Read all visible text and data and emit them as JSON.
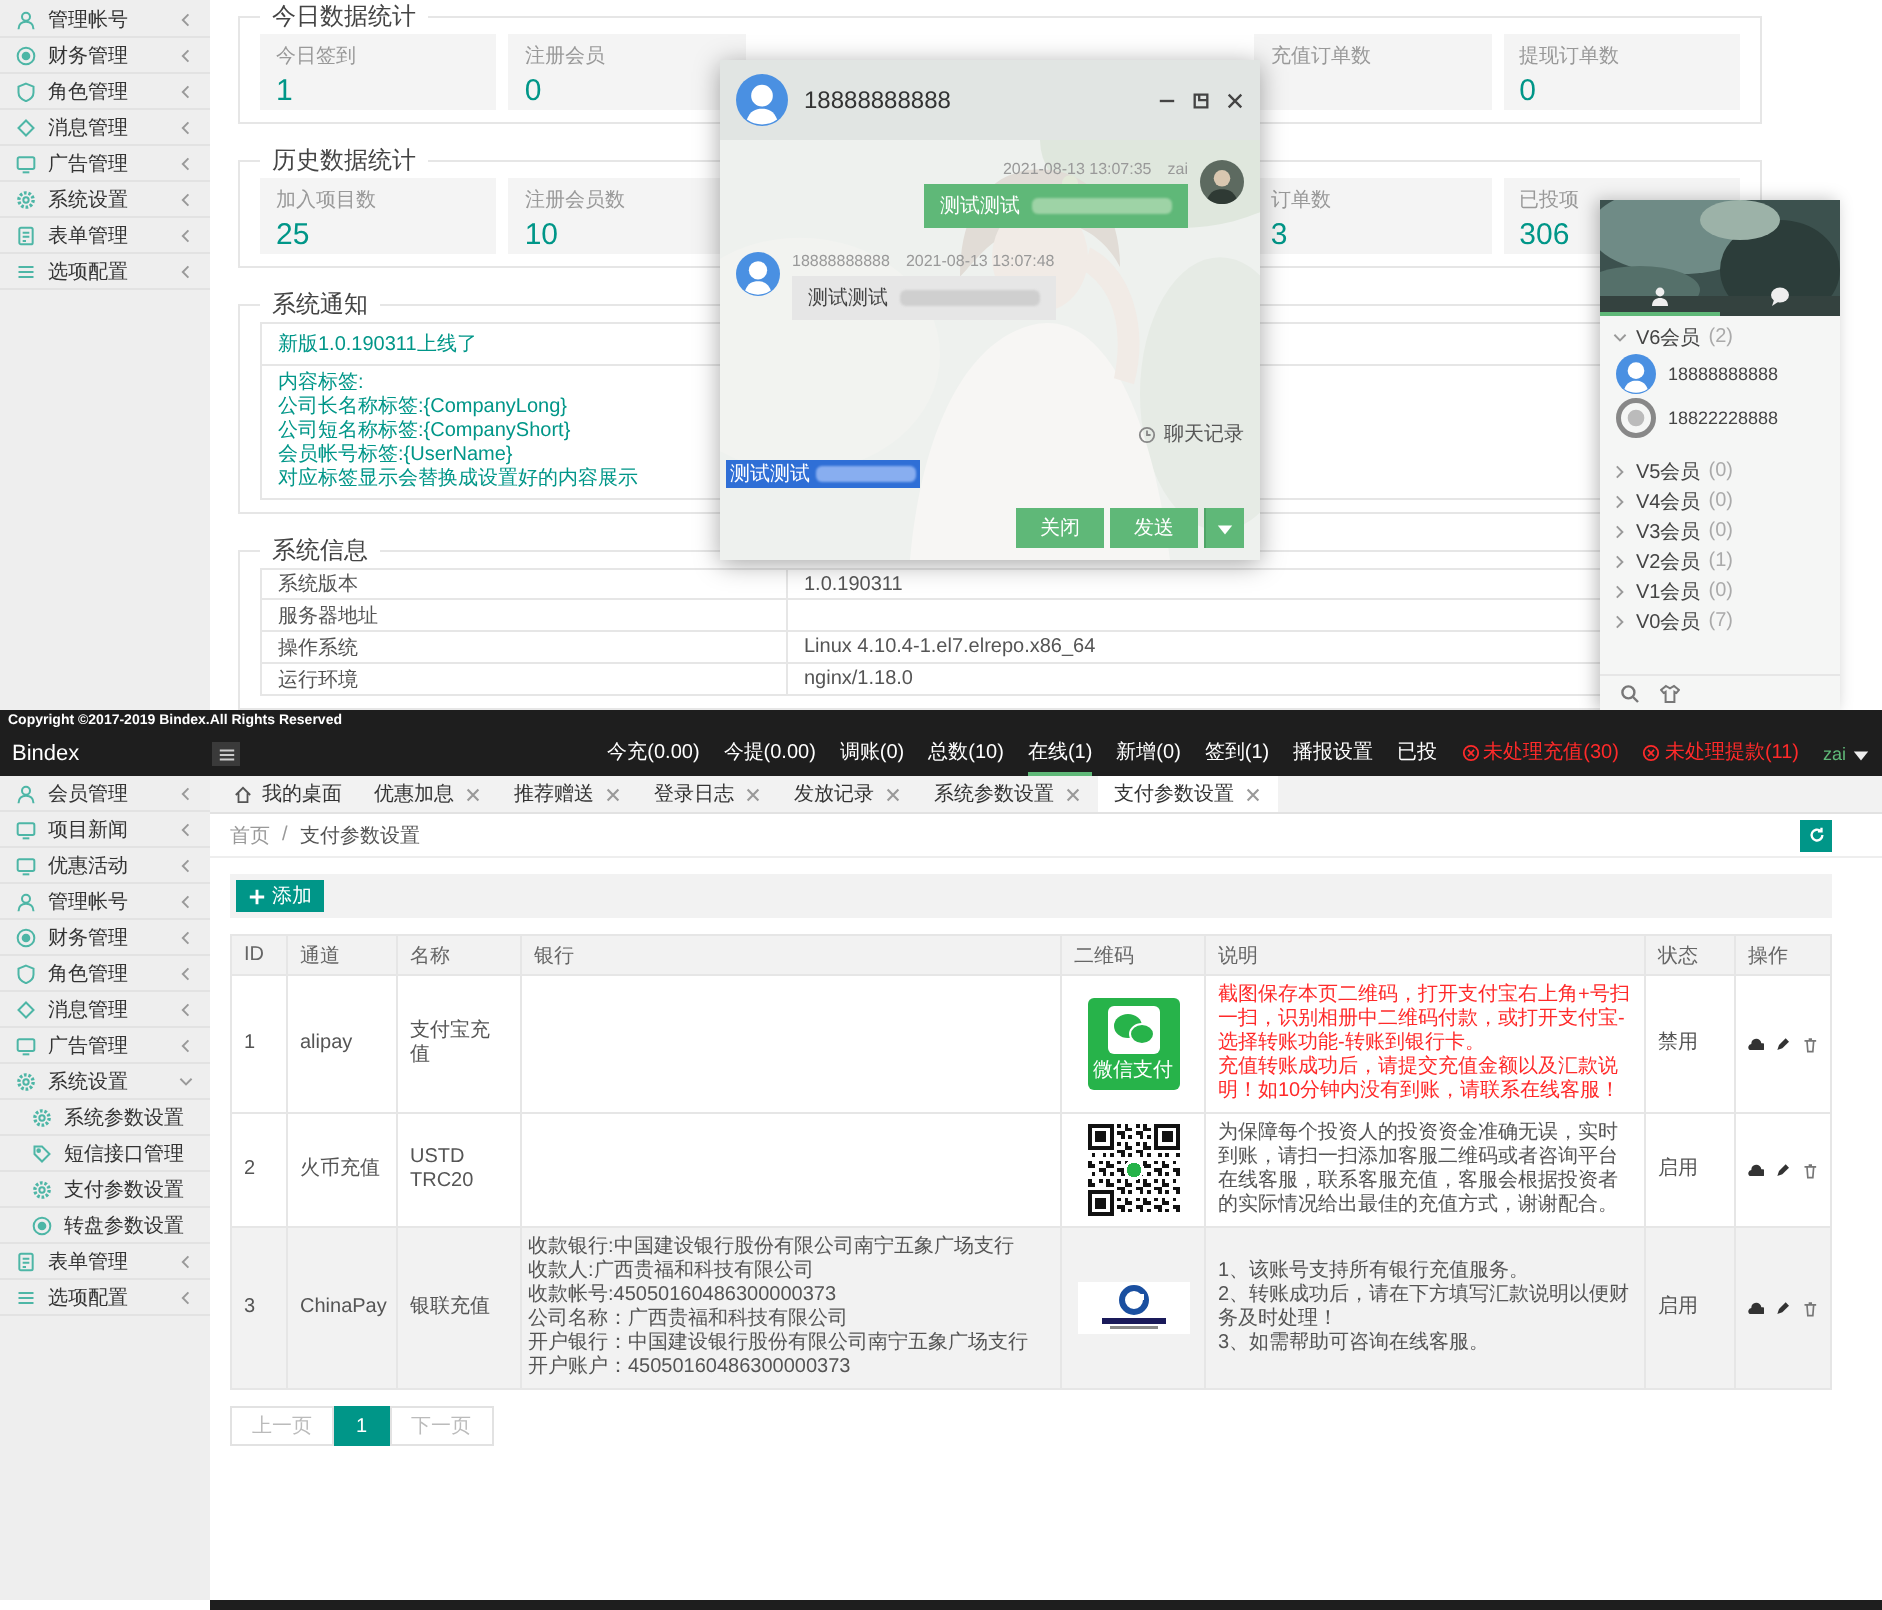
{
  "top": {
    "sidebar": {
      "items": [
        {
          "label": "管理帐号",
          "kind": "user",
          "expanded": false
        },
        {
          "label": "财务管理",
          "kind": "coin",
          "expanded": false
        },
        {
          "label": "角色管理",
          "kind": "shield",
          "expanded": false
        },
        {
          "label": "消息管理",
          "kind": "diamond",
          "expanded": false
        },
        {
          "label": "广告管理",
          "kind": "monitor",
          "expanded": false
        },
        {
          "label": "系统设置",
          "kind": "gear",
          "expanded": false
        },
        {
          "label": "表单管理",
          "kind": "document",
          "expanded": false
        },
        {
          "label": "选项配置",
          "kind": "list",
          "expanded": false
        }
      ]
    },
    "today_stats": {
      "title": "今日数据统计",
      "cards": [
        {
          "label": "今日签到",
          "value": "1"
        },
        {
          "label": "注册会员",
          "value": "0"
        },
        {
          "label": "充值订单数"
        },
        {
          "label": "提现订单数",
          "value": "0"
        }
      ]
    },
    "history_stats": {
      "title": "历史数据统计",
      "cards": [
        {
          "label": "加入项目数",
          "value": "25"
        },
        {
          "label": "注册会员数",
          "value": "10"
        },
        {
          "label": "订单数",
          "value": "3"
        },
        {
          "label": "已投项",
          "value": "306"
        }
      ]
    },
    "notice": {
      "title": "系统通知",
      "headline": "新版1.0.190311上线了",
      "lines": [
        "内容标签:",
        "公司长名称标签:{CompanyLong}",
        "公司短名称标签:{CompanyShort}",
        "会员帐号标签:{UserName}",
        "对应标签显示会替换成设置好的内容展示"
      ]
    },
    "system_info": {
      "title": "系统信息",
      "rows": [
        {
          "label": "系统版本",
          "value": "1.0.190311"
        },
        {
          "label": "服务器地址"
        },
        {
          "label": "操作系统",
          "value": "Linux 4.10.4-1.el7.elrepo.x86_64"
        },
        {
          "label": "运行环境",
          "value": "nginx/1.18.0"
        }
      ]
    },
    "chat_window": {
      "title": "18888888888",
      "messages": [
        {
          "kind": "sent",
          "time": "2021-08-13 13:07:35",
          "sender": "zai",
          "text": "测试测试"
        },
        {
          "kind": "received",
          "sender": "18888888888",
          "time": "2021-08-13 13:07:48",
          "text": "测试测试"
        }
      ],
      "history_link": "聊天记录",
      "draft": "测试测试",
      "close_button": "关闭",
      "send_button": "发送"
    },
    "friend_panel": {
      "tabs": [
        {
          "kind": "contacts",
          "selected": true
        },
        {
          "kind": "chats",
          "selected": false
        }
      ],
      "groups": [
        {
          "name": "V6会员",
          "count": "(2)",
          "expanded": true,
          "friends": [
            {
              "name": "18888888888",
              "kind": "cartoon"
            },
            {
              "name": "18822228888",
              "kind": "default"
            }
          ]
        },
        {
          "name": "V5会员",
          "count": "(0)",
          "expanded": false
        },
        {
          "name": "V4会员",
          "count": "(0)",
          "expanded": false
        },
        {
          "name": "V3会员",
          "count": "(0)",
          "expanded": false
        },
        {
          "name": "V2会员",
          "count": "(1)",
          "expanded": false
        },
        {
          "name": "V1会员",
          "count": "(0)",
          "expanded": false
        },
        {
          "name": "V0会员",
          "count": "(7)",
          "expanded": false
        }
      ]
    }
  },
  "bottom": {
    "copyright": "Copyright ©2017-2019 Bindex.All Rights Reserved",
    "logo": "Bindex",
    "nav": [
      {
        "label": "今充(0.00)",
        "kind": "stat",
        "selected": false
      },
      {
        "label": "今提(0.00)",
        "kind": "stat",
        "selected": false
      },
      {
        "label": "调账(0)",
        "kind": "stat",
        "selected": false
      },
      {
        "label": "总数(10)",
        "kind": "stat",
        "selected": false
      },
      {
        "label": "在线(1)",
        "kind": "stat",
        "selected": true
      },
      {
        "label": "新增(0)",
        "kind": "stat",
        "selected": false
      },
      {
        "label": "签到(1)",
        "kind": "stat",
        "selected": false
      },
      {
        "label": "播报设置",
        "kind": "stat",
        "selected": false
      },
      {
        "label": "已投",
        "kind": "stat",
        "selected": false
      },
      {
        "label": "未处理充值(30)",
        "kind": "alert",
        "selected": false
      },
      {
        "label": "未处理提款(11)",
        "kind": "alert",
        "selected": false
      }
    ],
    "user": "zai",
    "sidebar": {
      "items": [
        {
          "label": "会员管理",
          "kind": "user",
          "expanded": false
        },
        {
          "label": "项目新闻",
          "kind": "monitor",
          "expanded": false
        },
        {
          "label": "优惠活动",
          "kind": "monitor",
          "expanded": false
        },
        {
          "label": "管理帐号",
          "kind": "user",
          "expanded": false
        },
        {
          "label": "财务管理",
          "kind": "coin",
          "expanded": false
        },
        {
          "label": "角色管理",
          "kind": "shield",
          "expanded": false
        },
        {
          "label": "消息管理",
          "kind": "diamond",
          "expanded": false
        },
        {
          "label": "广告管理",
          "kind": "monitor",
          "expanded": false
        },
        {
          "label": "系统设置",
          "kind": "gear",
          "expanded": true,
          "children": [
            {
              "label": "系统参数设置",
              "kind": "gear"
            },
            {
              "label": "短信接口管理",
              "kind": "tag"
            },
            {
              "label": "支付参数设置",
              "kind": "gear"
            },
            {
              "label": "转盘参数设置",
              "kind": "coin"
            }
          ]
        },
        {
          "label": "表单管理",
          "kind": "document",
          "expanded": false
        },
        {
          "label": "选项配置",
          "kind": "list",
          "expanded": false
        }
      ]
    },
    "tabs": [
      {
        "label": "我的桌面",
        "kind": "home",
        "selected": false
      },
      {
        "label": "优惠加息",
        "kind": "page",
        "selected": false
      },
      {
        "label": "推荐赠送",
        "kind": "page",
        "selected": false
      },
      {
        "label": "登录日志",
        "kind": "page",
        "selected": false
      },
      {
        "label": "发放记录",
        "kind": "page",
        "selected": false
      },
      {
        "label": "系统参数设置",
        "kind": "page",
        "selected": false
      },
      {
        "label": "支付参数设置",
        "kind": "page",
        "selected": true
      }
    ],
    "breadcrumb": {
      "items": [
        "首页",
        "支付参数设置"
      ],
      "separator": "/"
    },
    "add_button": "添加",
    "table": {
      "columns": [
        "ID",
        "通道",
        "名称",
        "银行",
        "二维码",
        "说明",
        "状态",
        "操作"
      ],
      "rows": [
        {
          "id": "1",
          "channel": "alipay",
          "name": "支付宝充值",
          "qr": {
            "kind": "wechat-pay",
            "caption": "微信支付"
          },
          "note": {
            "kind": "alert",
            "lines": [
              "截图保存本页二维码，打开支付宝右上角+号扫一扫，识别相册中二维码付款，或打开支付宝-选择转账功能-转账到银行卡。",
              "充值转账成功后，请提交充值金额以及汇款说明！如10分钟内没有到账，请联系在线客服！"
            ]
          },
          "status": "禁用",
          "selected": false
        },
        {
          "id": "2",
          "channel": "火币充值",
          "name": "USTD TRC20",
          "qr": {
            "kind": "qr-code"
          },
          "note": {
            "kind": "plain",
            "lines": [
              "为保障每个投资人的投资资金准确无误，实时到账，请扫一扫添加客服二维码或者咨询平台在线客服，联系客服充值，客服会根据投资者的实际情况给出最佳的充值方式，谢谢配合。"
            ]
          },
          "status": "启用",
          "selected": false
        },
        {
          "id": "3",
          "channel": "ChinaPay",
          "name": "银联充值",
          "bank": [
            "收款银行:中国建设银行股份有限公司南宁五象广场支行",
            "收款人:广西贵福和科技有限公司",
            "收款帐号:45050160486300000373",
            "公司名称：广西贵福和科技有限公司",
            "开户银行：中国建设银行股份有限公司南宁五象广场支行",
            "开户账户：45050160486300000373"
          ],
          "qr": {
            "kind": "bank-logo"
          },
          "note": {
            "kind": "plain",
            "lines": [
              "1、该账号支持所有银行充值服务。",
              "2、转账成功后，请在下方填写汇款说明以便财务及时处理！",
              "3、如需帮助可咨询在线客服。"
            ]
          },
          "status": "启用",
          "selected": true
        }
      ]
    },
    "pagination": {
      "prev": "上一页",
      "pages": [
        {
          "label": "1",
          "selected": true
        }
      ],
      "next": "下一页"
    }
  }
}
